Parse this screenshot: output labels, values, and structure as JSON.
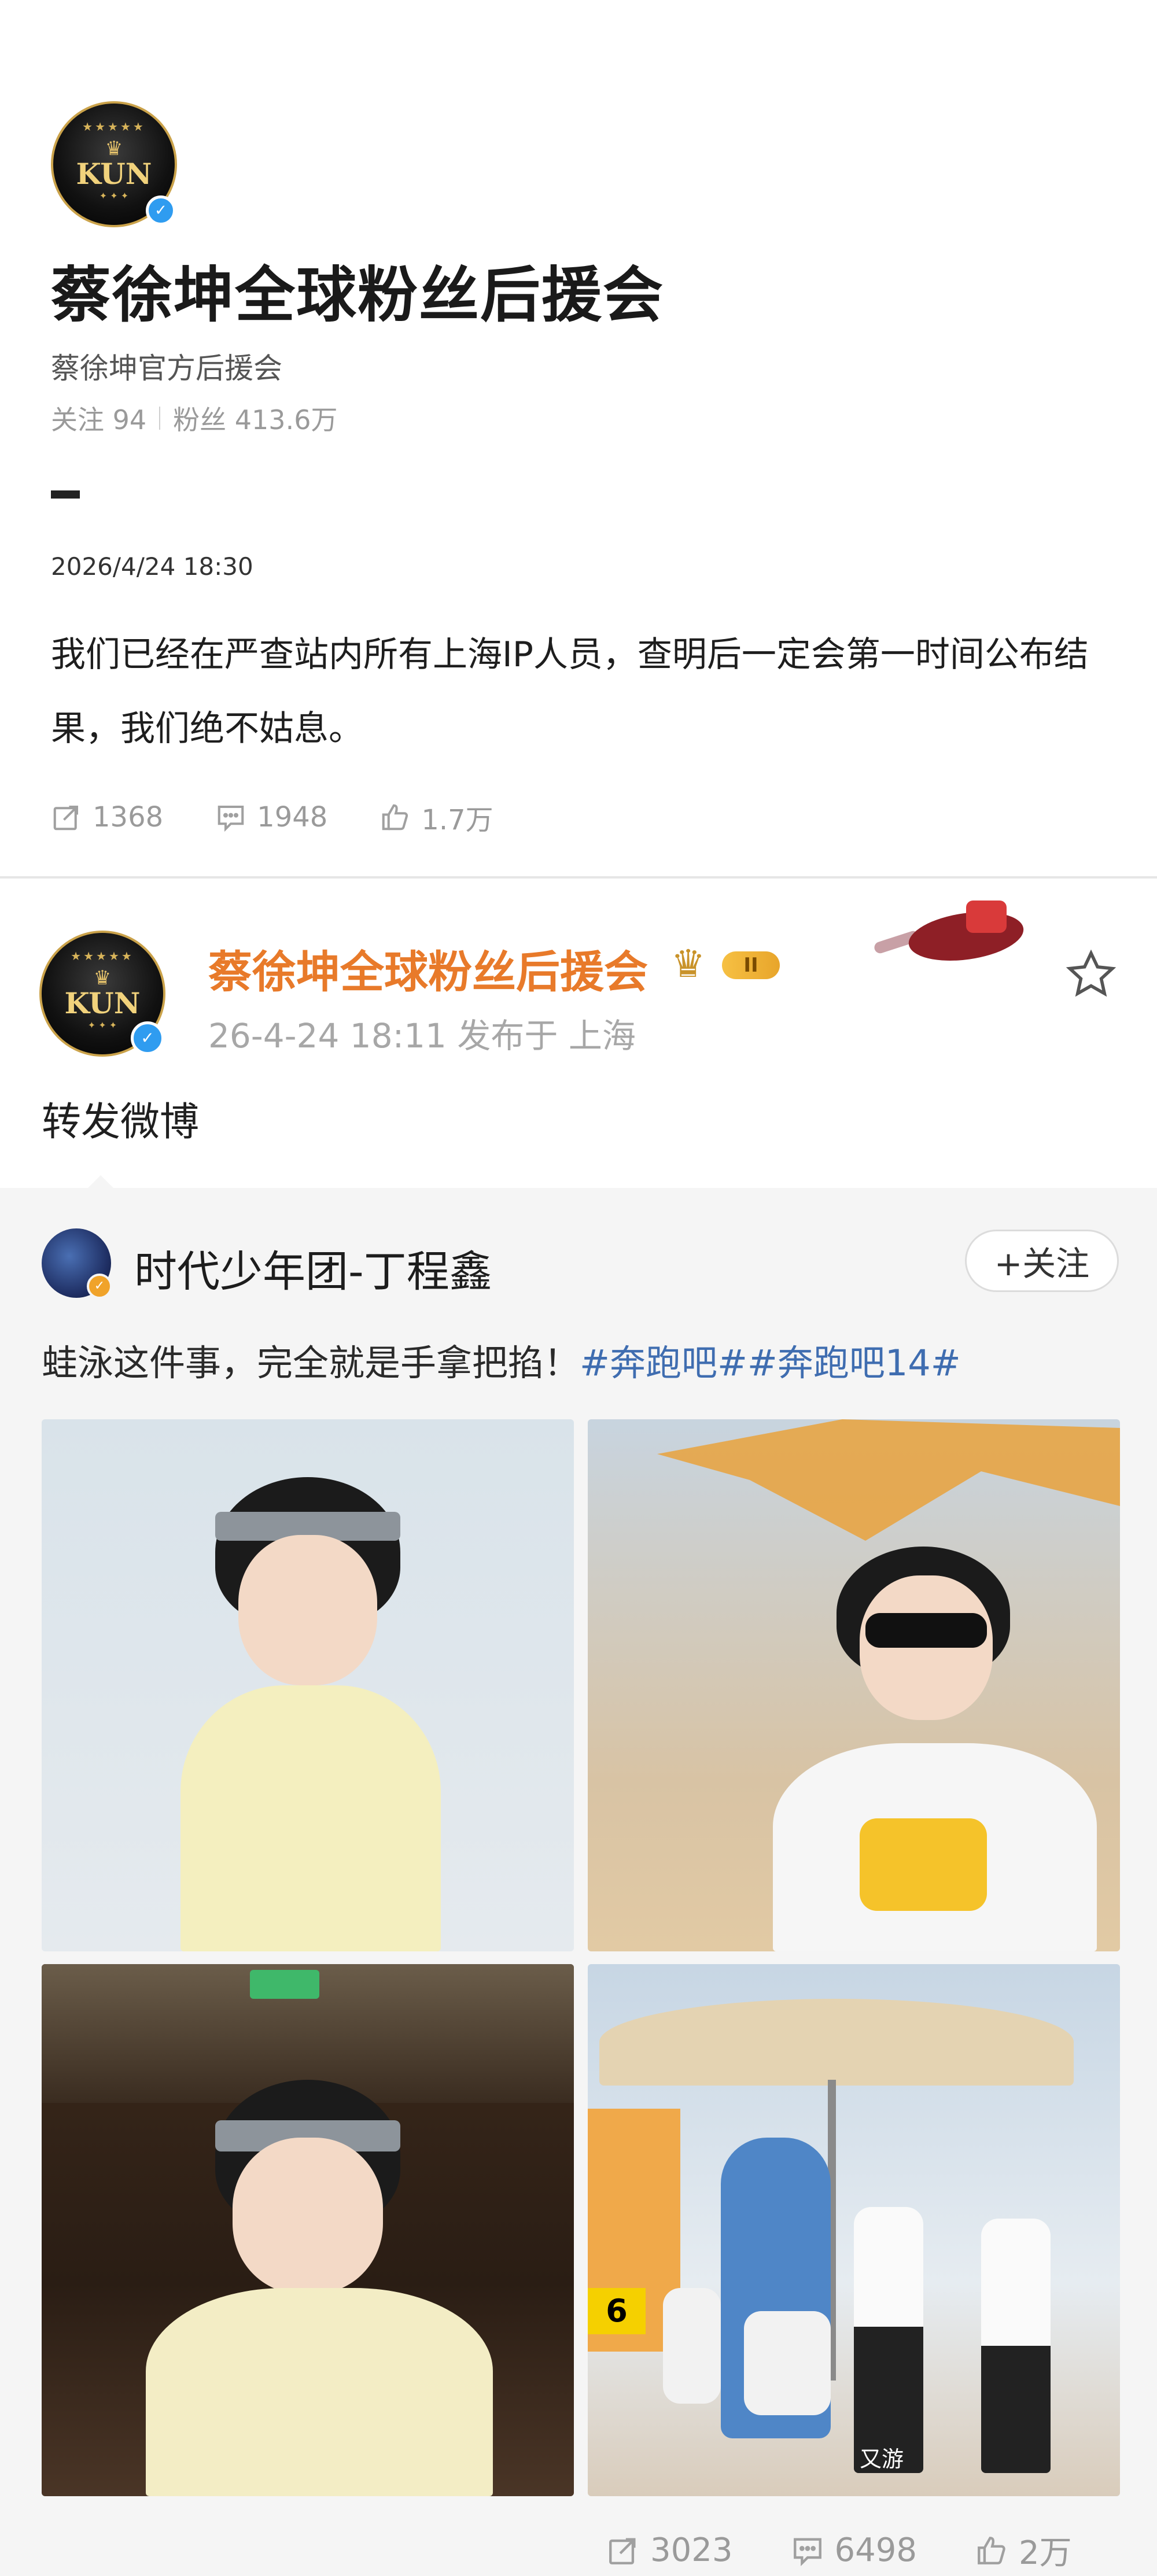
{
  "post1": {
    "avatar_text": "KUN",
    "account_name": "蔡徐坤全球粉丝后援会",
    "account_desc": "蔡徐坤官方后援会",
    "following": "关注 94",
    "followers": "粉丝 413.6万",
    "date": "2026/4/24 18:30",
    "content": "我们已经在严查站内所有上海IP人员，查明后一定会第一时间公布结果，我们绝不姑息。",
    "reposts": "1368",
    "comments": "1948",
    "likes": "1.7万"
  },
  "post2": {
    "avatar_text": "KUN",
    "account_name": "蔡徐坤全球粉丝后援会",
    "vip_level": "II",
    "meta": "26-4-24 18:11  发布于 上海",
    "text": "转发微博"
  },
  "original": {
    "author": "时代少年团-丁程鑫",
    "follow_label": "+关注",
    "content_plain": "蛙泳这件事，完全就是手拿把掐！",
    "hashtags": "#奔跑吧##奔跑吧14#",
    "photo3_sign": "6",
    "photo4_caption": "又游",
    "reposts": "3023",
    "comments": "6498",
    "likes": "2万"
  },
  "icons": {
    "repost": "repost-icon",
    "comment": "comment-icon",
    "like": "like-icon",
    "star": "star-icon",
    "verified": "verified-icon",
    "crown": "crown-icon"
  },
  "colors": {
    "orange_name": "#e87a2a",
    "verified_blue": "#2f9cf0",
    "hashtag_blue": "#3f6db0",
    "meta_gray": "#9a9a9a"
  }
}
